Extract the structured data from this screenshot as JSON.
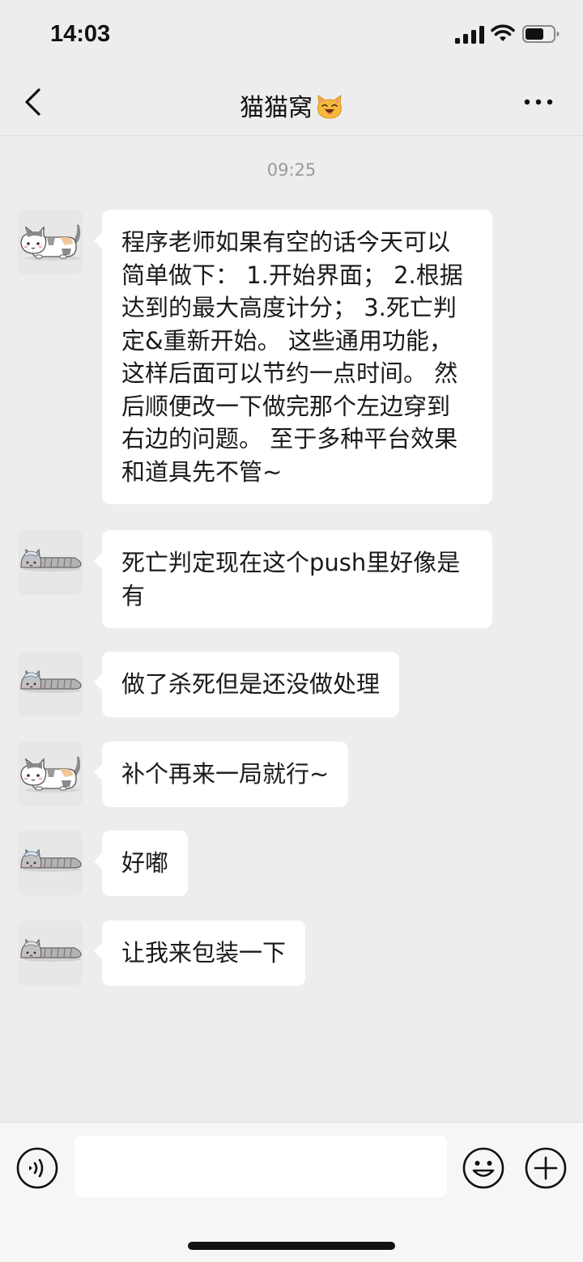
{
  "status_bar": {
    "time": "14:03",
    "icons": [
      "signal-icon",
      "wifi-icon",
      "battery-icon"
    ]
  },
  "nav": {
    "title": "猫猫窝",
    "title_icon": "cat-face-emoji",
    "left_icon": "back-chevron-icon",
    "right_icon": "more-dots-icon"
  },
  "chat": {
    "timestamp": "09:25",
    "messages": [
      {
        "sender_avatar": "calico-cat-avatar",
        "text": "程序老师如果有空的话今天可以简单做下： 1.开始界面； 2.根据达到的最大高度计分； 3.死亡判定&重新开始。 这些通用功能，这样后面可以节约一点时间。 然后顺便改一下做完那个左边穿到右边的问题。 至于多种平台效果和道具先不管~"
      },
      {
        "sender_avatar": "grey-cat-avatar",
        "text": "死亡判定现在这个push里好像是有"
      },
      {
        "sender_avatar": "grey-cat-avatar",
        "text": "做了杀死但是还没做处理"
      },
      {
        "sender_avatar": "calico-cat-avatar",
        "text": "补个再来一局就行~"
      },
      {
        "sender_avatar": "grey-cat-avatar",
        "text": "好嘟"
      },
      {
        "sender_avatar": "grey-cat-avatar",
        "text": "让我来包装一下"
      }
    ]
  },
  "input_bar": {
    "value": "",
    "icons": [
      "voice-icon",
      "emoji-icon",
      "plus-icon"
    ]
  },
  "colors": {
    "background": "#ededed",
    "bubble": "#ffffff",
    "timestamp": "#9a9a9a"
  }
}
